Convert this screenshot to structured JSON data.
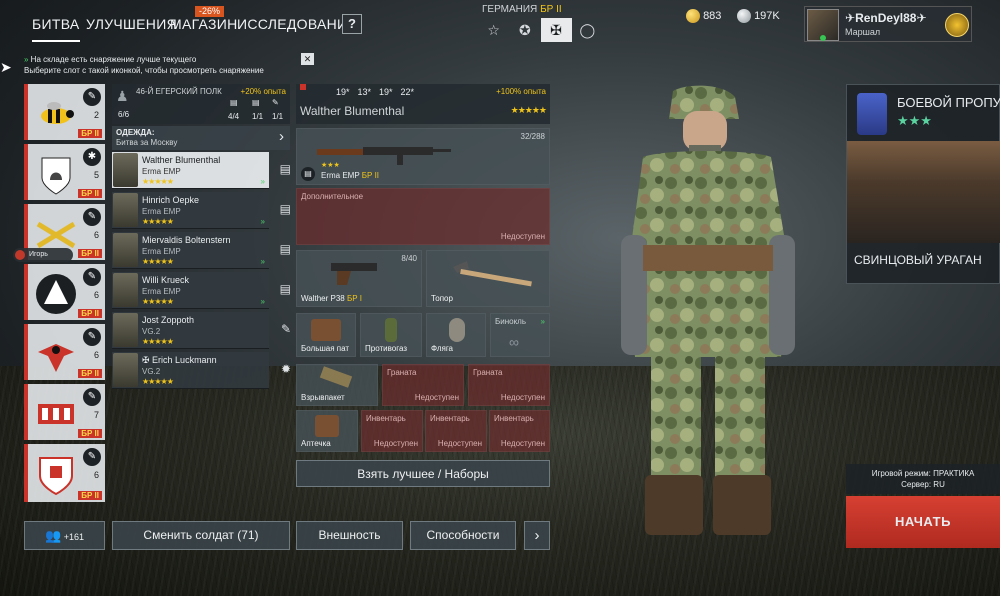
{
  "nav": {
    "tabs": [
      "БИТВА",
      "УЛУЧШЕНИЯ",
      "МАГАЗИН",
      "ИССЛЕДОВАНИЯ"
    ],
    "sale_badge": "-26%",
    "help": "?"
  },
  "nation": {
    "label": "ГЕРМАНИЯ",
    "rank": "БР II",
    "icons": [
      "☆",
      "✪",
      "✠",
      "◯"
    ]
  },
  "currency": {
    "gold": "883",
    "silver": "197K"
  },
  "player": {
    "name": "RenDeyl88",
    "rank": "Маршал"
  },
  "hint": {
    "line1": "На складе есть снаряжение лучше текущего",
    "line2": "Выберите слот с такой иконкой, чтобы просмотреть снаряжение",
    "close": "✕"
  },
  "squads": [
    {
      "count": "2",
      "br": "БР II"
    },
    {
      "count": "5",
      "br": "БР II"
    },
    {
      "count": "6",
      "br": "БР II"
    },
    {
      "count": "6",
      "br": "БР II"
    },
    {
      "count": "6",
      "br": "БР II"
    },
    {
      "count": "7",
      "br": "БР II"
    },
    {
      "count": "6",
      "br": "БР II"
    }
  ],
  "squad_info": {
    "name": "46-Й ЕГЕРСКИЙ ПОЛК",
    "xp": "+20% опыта",
    "size": "6/6",
    "c1": "4/4",
    "c2": "1/1",
    "c3": "1/1",
    "outfit_label": "ОДЕЖДА:",
    "outfit_value": "Битва за Москву",
    "squad_badge": "+161",
    "player_tag": "Игорь"
  },
  "soldiers": [
    {
      "name": "Walther Blumenthal",
      "weapon": "Erma EMP",
      "stars": "★★★★★"
    },
    {
      "name": "Hinrich Oepke",
      "weapon": "Erma EMP",
      "stars": "★★★★★"
    },
    {
      "name": "Miervaldis Boltenstern",
      "weapon": "Erma EMP",
      "stars": "★★★★★"
    },
    {
      "name": "Willi Krueck",
      "weapon": "Erma EMP",
      "stars": "★★★★★"
    },
    {
      "name": "Jost Zoppoth",
      "weapon": "VG.2",
      "stars": "★★★★★"
    },
    {
      "name": "Erich Luckmann",
      "weapon": "VG.2",
      "stars": "★★★★★"
    }
  ],
  "soldier_detail": {
    "name": "Walther Blumenthal",
    "stats": [
      "19*",
      "13*",
      "19*",
      "22*"
    ],
    "xp": "+100% опыта",
    "stars": "★★★★★"
  },
  "equipment": {
    "primary": {
      "name": "Erma EMP",
      "br": "БР II",
      "ammo": "32/288"
    },
    "additional": {
      "title": "Дополнительное",
      "status": "Недоступен"
    },
    "sidearm": {
      "name": "Walther P38",
      "br": "БР I",
      "ammo": "8/40"
    },
    "melee": {
      "name": "Топор"
    },
    "pouch": "Большая пат",
    "gasmask": "Противогаз",
    "flask": "Фляга",
    "binoc": "Бинокль",
    "explosive": "Взрывпакет",
    "grenade": "Граната",
    "inventory": "Инвентарь",
    "medkit": "Аптечка",
    "unavailable": "Недоступен"
  },
  "buttons": {
    "best": "Взять лучшее / Наборы",
    "change": "Сменить солдат (71)",
    "appearance": "Внешность",
    "abilities": "Способности",
    "more": "›"
  },
  "battlepass": {
    "title": "БОЕВОЙ ПРОПУ",
    "event": "СВИНЦОВЫЙ УРАГАН"
  },
  "mode": {
    "label": "Игровой режим: ПРАКТИКА",
    "server": "Сервер: RU",
    "start": "НАЧАТЬ"
  }
}
